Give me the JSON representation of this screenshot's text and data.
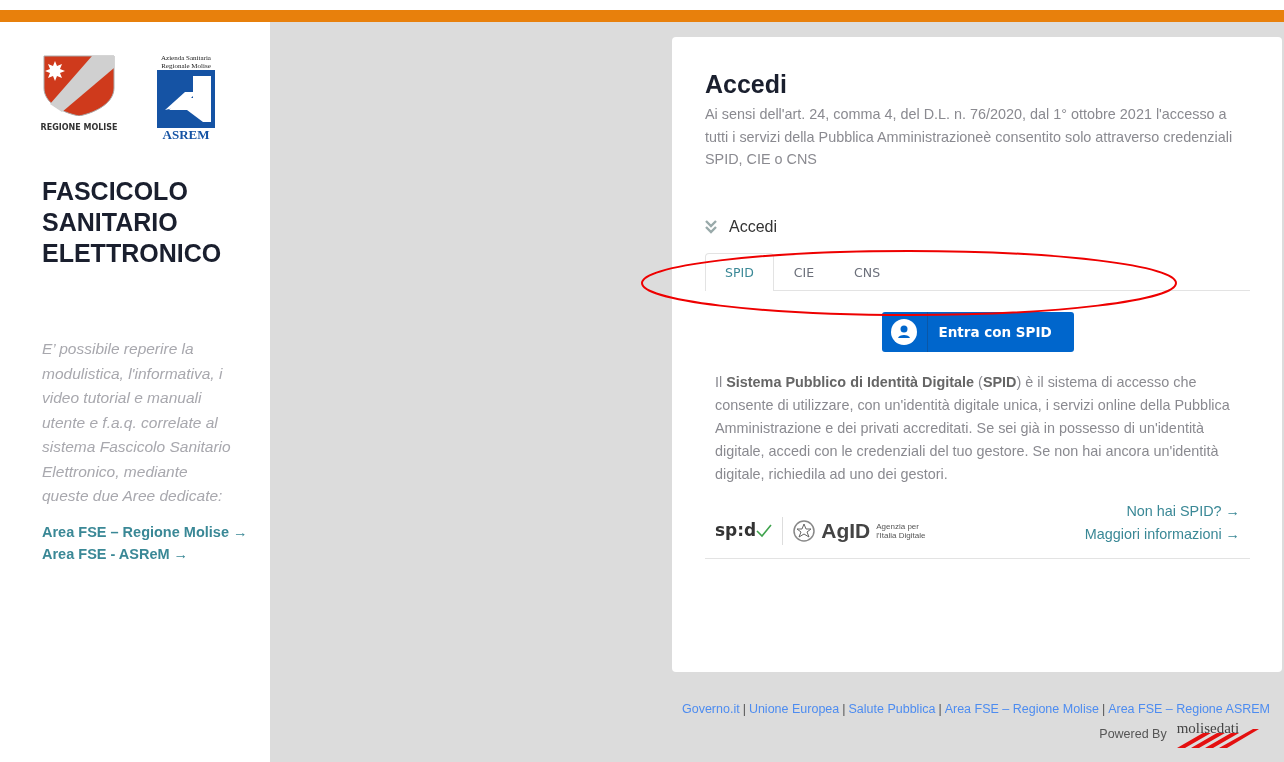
{
  "sidebar": {
    "logos": [
      {
        "kind": "region",
        "caption": "REGIONE MOLISE"
      },
      {
        "kind": "asrem",
        "caption_top": "Azienda Sanitaria Regionale Molise",
        "caption_bottom": "ASREM"
      }
    ],
    "title_lines": [
      "FASCICOLO",
      "SANITARIO",
      "ELETTRONICO"
    ],
    "intro": "E’ possibile reperire la modulistica, l'informativa, i video tutorial e manuali utente e f.a.q. correlate al sistema Fascicolo Sanitario Elettronico, mediante queste due Aree dedicate:",
    "links": [
      "Area FSE – Regione Molise →",
      "Area FSE - ASReM →"
    ]
  },
  "card": {
    "title": "Accedi",
    "notice": "Ai sensi dell'art. 24, comma 4, del D.L. n. 76/2020, dal 1° ottobre 2021 l'accesso a tutti i servizi della Pubblica Amministrazioneè consentito solo attraverso credenziali SPID, CIE o CNS",
    "section": {
      "label": "Accedi",
      "expanded": true
    },
    "tabs": [
      {
        "label": "SPID",
        "selected": true
      },
      {
        "label": "CIE",
        "selected": false
      },
      {
        "label": "CNS",
        "selected": false
      }
    ],
    "login_button": "Entra con SPID",
    "description": "Il **Sistema Pubblico di Identità Digitale** (**SPID**) è il sistema di accesso che consente di utilizzare, con un'identità digitale unica, i servizi online della Pubblica Amministrazione e dei privati accreditati. Se sei già in possesso di un'identità digitale, accedi con le credenziali del tuo gestore. Se non hai ancora un'identità digitale, richiedila ad uno dei gestori.",
    "spid_logo": "sp:d",
    "agid_logo": "AgID",
    "agid_caption": "Agenzia per l'Italia Digitale",
    "links": [
      "Non hai SPID? →",
      "Maggiori informazioni →"
    ]
  },
  "highlight_ellipse": true,
  "footer": {
    "links": [
      "Governo.it",
      "Unione Europea",
      "Salute Pubblica",
      "Area FSE – Regione Molise",
      "Area FSE – Regione ASREM"
    ],
    "separator": "|",
    "powered_by": "Powered By",
    "brand": "molisedati"
  }
}
